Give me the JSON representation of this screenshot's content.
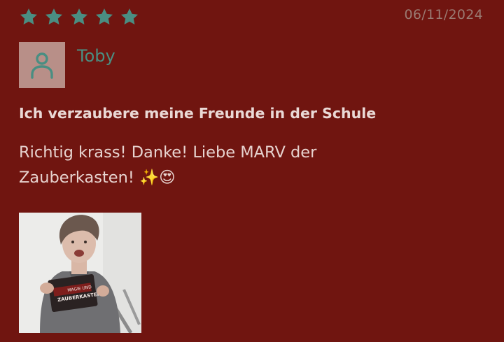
{
  "review": {
    "rating": 5,
    "rating_max": 5,
    "date": "06/11/2024",
    "author": "Toby",
    "title": "Ich verzaubere meine Freunde in der Schule",
    "text": "Richtig krass! Danke! Liebe MARV der Zauberkasten! ✨😍",
    "photo": {
      "box_text_top": "MAGIE UND",
      "box_text_main": "ZAUBERKASTEN"
    }
  },
  "icons": {
    "star": "star-icon",
    "avatar": "user-icon"
  },
  "colors": {
    "background": "#701510",
    "star": "#4a8e82",
    "author": "#4a8e82",
    "date": "#9a7a72",
    "title": "#ead9d6",
    "text": "#e7d3cf",
    "avatar_bg": "#b88f88"
  }
}
